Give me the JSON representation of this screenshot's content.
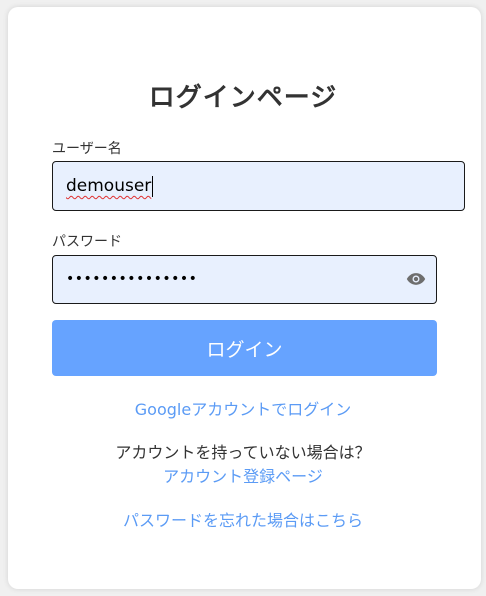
{
  "title": "ログインページ",
  "username": {
    "label": "ユーザー名",
    "value": "demouser"
  },
  "password": {
    "label": "パスワード",
    "masked_value": "•••••••••••••••",
    "toggle_icon": "eye-icon"
  },
  "login_button": "ログイン",
  "google_link": "Googleアカウントでログイン",
  "no_account_text": "アカウントを持っていない場合は？",
  "register_link": "アカウント登録ページ",
  "forgot_link": "パスワードを忘れた場合はこちら",
  "colors": {
    "primary": "#66a3ff",
    "link": "#5b9bf5",
    "input_bg": "#e8f0fe"
  }
}
